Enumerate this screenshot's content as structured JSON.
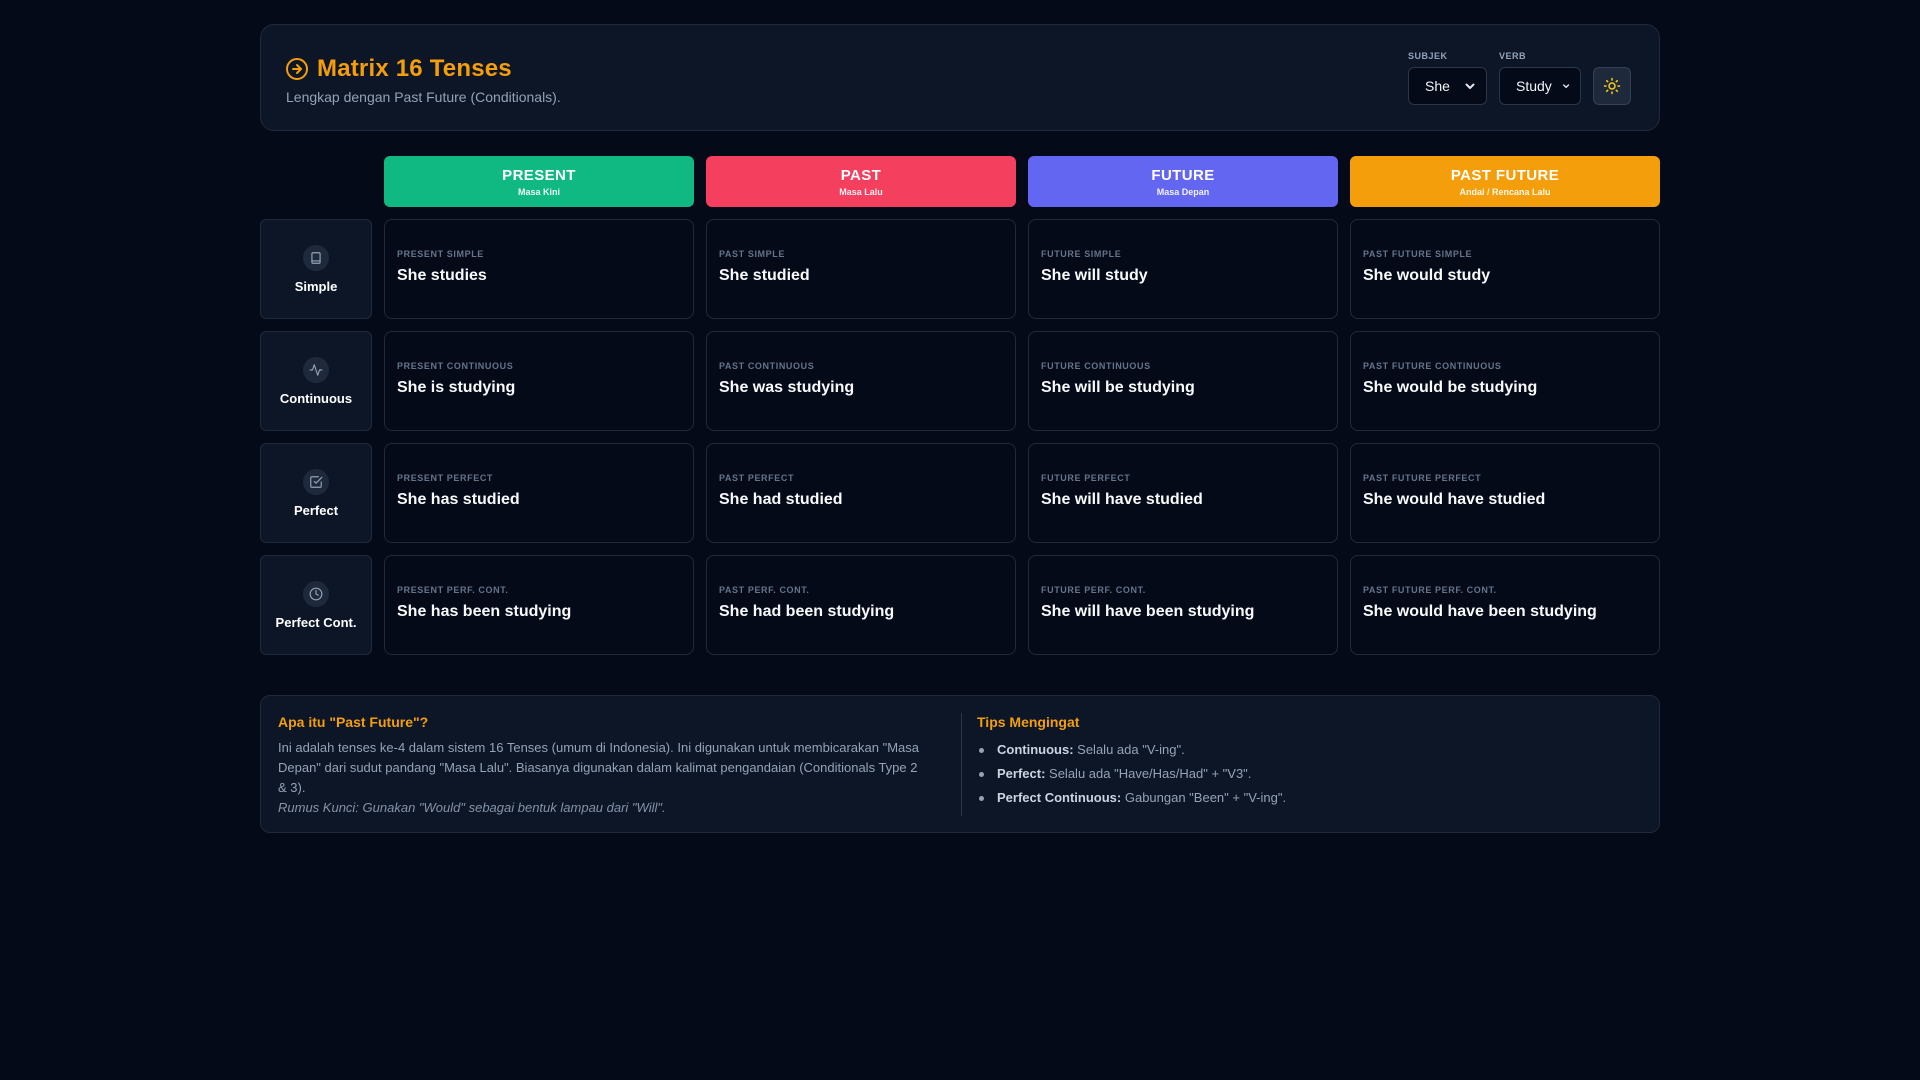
{
  "header": {
    "title": "Matrix 16 Tenses",
    "subtitle": "Lengkap dengan Past Future (Conditionals).",
    "accent": "#f59e0b",
    "icon": "arrow-circle-right-icon"
  },
  "controls": {
    "subject": {
      "label": "SUBJEK",
      "value": "She"
    },
    "verb": {
      "label": "VERB",
      "value": "Study"
    },
    "theme_toggle_icon": "sun-icon"
  },
  "columns": [
    {
      "name": "PRESENT",
      "sub": "Masa Kini",
      "color": "#10b981"
    },
    {
      "name": "PAST",
      "sub": "Masa Lalu",
      "color": "#f43f5e"
    },
    {
      "name": "FUTURE",
      "sub": "Masa Depan",
      "color": "#6366f1"
    },
    {
      "name": "PAST FUTURE",
      "sub": "Andai / Rencana Lalu",
      "color": "#f59e0b"
    }
  ],
  "rows": [
    {
      "label": "Simple",
      "icon": "book-icon",
      "cells": [
        {
          "tense": "PRESENT SIMPLE",
          "sentence": "She studies"
        },
        {
          "tense": "PAST SIMPLE",
          "sentence": "She studied"
        },
        {
          "tense": "FUTURE SIMPLE",
          "sentence": "She will study"
        },
        {
          "tense": "PAST FUTURE SIMPLE",
          "sentence": "She would study"
        }
      ]
    },
    {
      "label": "Continuous",
      "icon": "activity-icon",
      "cells": [
        {
          "tense": "PRESENT CONTINUOUS",
          "sentence": "She is studying"
        },
        {
          "tense": "PAST CONTINUOUS",
          "sentence": "She was studying"
        },
        {
          "tense": "FUTURE CONTINUOUS",
          "sentence": "She will be studying"
        },
        {
          "tense": "PAST FUTURE CONTINUOUS",
          "sentence": "She would be studying"
        }
      ]
    },
    {
      "label": "Perfect",
      "icon": "check-square-icon",
      "cells": [
        {
          "tense": "PRESENT PERFECT",
          "sentence": "She has studied"
        },
        {
          "tense": "PAST PERFECT",
          "sentence": "She had studied"
        },
        {
          "tense": "FUTURE PERFECT",
          "sentence": "She will have studied"
        },
        {
          "tense": "PAST FUTURE PERFECT",
          "sentence": "She would have studied"
        }
      ]
    },
    {
      "label": "Perfect Cont.",
      "icon": "clock-icon",
      "cells": [
        {
          "tense": "PRESENT PERF. CONT.",
          "sentence": "She has been studying"
        },
        {
          "tense": "PAST PERF. CONT.",
          "sentence": "She had been studying"
        },
        {
          "tense": "FUTURE PERF. CONT.",
          "sentence": "She will have been studying"
        },
        {
          "tense": "PAST FUTURE PERF. CONT.",
          "sentence": "She would have been studying"
        }
      ]
    }
  ],
  "info": {
    "left_title": "Apa itu \"Past Future\"?",
    "left_text": "Ini adalah tenses ke-4 dalam sistem 16 Tenses (umum di Indonesia). Ini digunakan untuk membicarakan \"Masa Depan\" dari sudut pandang \"Masa Lalu\". Biasanya digunakan dalam kalimat pengandaian (Conditionals Type 2 & 3).",
    "left_key": "Rumus Kunci: Gunakan \"Would\" sebagai bentuk lampau dari \"Will\".",
    "right_title": "Tips Mengingat",
    "tips": [
      {
        "term": "Continuous:",
        "text": " Selalu ada \"V-ing\"."
      },
      {
        "term": "Perfect:",
        "text": " Selalu ada \"Have/Has/Had\" + \"V3\"."
      },
      {
        "term": "Perfect Continuous:",
        "text": " Gabungan \"Been\" + \"V-ing\"."
      }
    ]
  }
}
